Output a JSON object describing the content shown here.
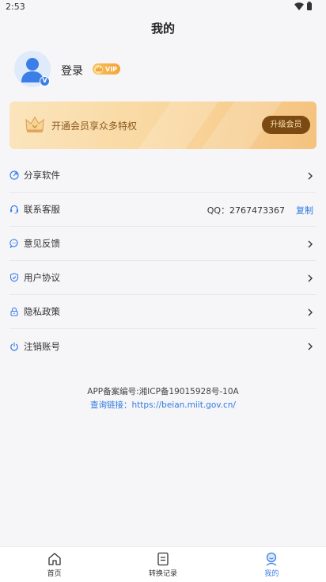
{
  "status_bar": {
    "time": "2:53"
  },
  "header": {
    "title": "我的"
  },
  "profile": {
    "login_label": "登录",
    "vip_badge": "VIP",
    "avatar_badge": "V"
  },
  "vip_banner": {
    "text": "开通会员享众多特权",
    "button": "升级会员"
  },
  "menu": {
    "items": [
      {
        "label": "分享软件",
        "icon": "share-icon"
      },
      {
        "label": "联系客服",
        "icon": "headset-icon",
        "qq": "QQ：2767473367",
        "action": "复制"
      },
      {
        "label": "意见反馈",
        "icon": "chat-bubble-icon"
      },
      {
        "label": "用户协议",
        "icon": "shield-check-icon"
      },
      {
        "label": "隐私政策",
        "icon": "lock-icon"
      },
      {
        "label": "注销账号",
        "icon": "power-icon"
      }
    ]
  },
  "footer": {
    "beian": "APP备案编号:湘ICP备19015928号-10A",
    "query_link": "查询链接：https://beian.miit.gov.cn/"
  },
  "bottom_nav": {
    "items": [
      {
        "label": "首页",
        "icon": "home-icon"
      },
      {
        "label": "转换记录",
        "icon": "document-icon"
      },
      {
        "label": "我的",
        "icon": "profile-icon"
      }
    ],
    "active_index": 2
  },
  "colors": {
    "accent": "#3b7ee8",
    "link": "#2f7ae0",
    "vip_button": "#7a4a12",
    "background": "#f6f6f9"
  }
}
